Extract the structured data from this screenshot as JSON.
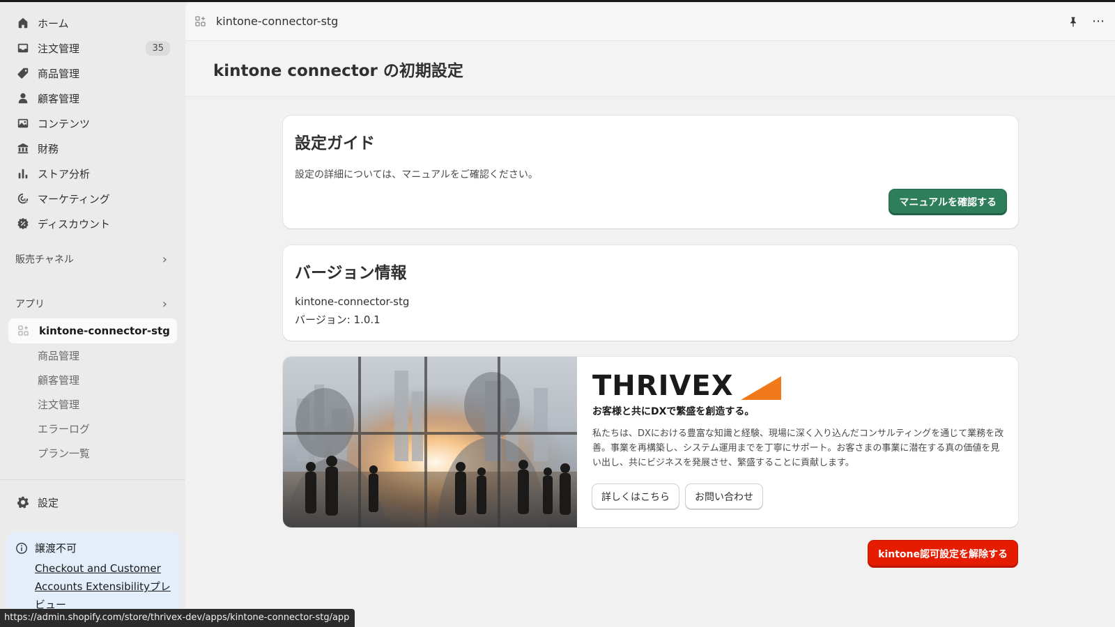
{
  "sidebar": {
    "nav": [
      {
        "label": "ホーム",
        "icon": "home-icon"
      },
      {
        "label": "注文管理",
        "icon": "inbox-icon",
        "badge": "35"
      },
      {
        "label": "商品管理",
        "icon": "tag-icon"
      },
      {
        "label": "顧客管理",
        "icon": "person-icon"
      },
      {
        "label": "コンテンツ",
        "icon": "image-icon"
      },
      {
        "label": "財務",
        "icon": "bank-icon"
      },
      {
        "label": "ストア分析",
        "icon": "bar-chart-icon"
      },
      {
        "label": "マーケティング",
        "icon": "target-icon"
      },
      {
        "label": "ディスカウント",
        "icon": "discount-icon"
      }
    ],
    "sales_channels": "販売チャネル",
    "apps": "アプリ",
    "active_app": "kintone-connector-stg",
    "app_sub": [
      "商品管理",
      "顧客管理",
      "注文管理",
      "エラーログ",
      "プラン一覧"
    ],
    "settings": "設定",
    "notice": {
      "title": "譲渡不可",
      "link": "Checkout and Customer Accounts Extensibilityプレビュー"
    }
  },
  "status_url": "https://admin.shopify.com/store/thrivex-dev/apps/kintone-connector-stg/app",
  "header": {
    "app_name": "kintone-connector-stg"
  },
  "page": {
    "title": "kintone connector の初期設定"
  },
  "guide": {
    "title": "設定ガイド",
    "desc": "設定の詳細については、マニュアルをご確認ください。",
    "button": "マニュアルを確認する"
  },
  "version": {
    "title": "バージョン情報",
    "name": "kintone-connector-stg",
    "version": "バージョン: 1.0.1"
  },
  "banner": {
    "logo": "THRIVEX",
    "tagline": "お客様と共にDXで繁盛を創造する。",
    "desc": "私たちは、DXにおける豊富な知識と経験、現場に深く入り込んだコンサルティングを通じて業務を改善。事業を再構築し、システム運用までを丁寧にサポート。お客さまの事業に潜在する真の価値を見い出し、共にビジネスを発展させ、繁盛することに貢献します。",
    "btn_more": "詳しくはこちら",
    "btn_contact": "お問い合わせ"
  },
  "unlink_button": "kintone認可設定を解除する",
  "colors": {
    "primary_green": "#2e7d5b",
    "danger_red": "#e51c00",
    "logo_orange": "#f07a1a"
  }
}
